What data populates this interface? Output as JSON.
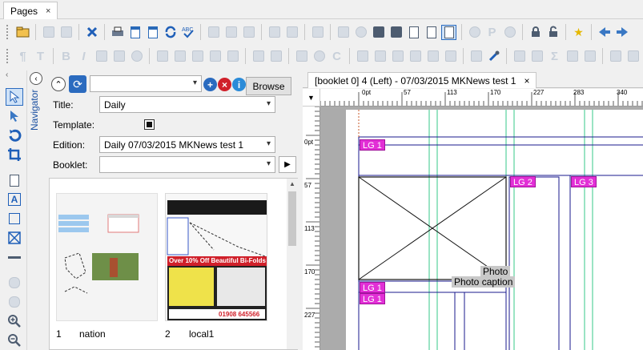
{
  "app": {
    "pages_tab_label": "Pages",
    "tab_close": "×"
  },
  "navigator": {
    "label": "Navigator"
  },
  "panel": {
    "browse_label": "Browse",
    "title_label": "Title:",
    "title_value": "Daily",
    "template_label": "Template:",
    "edition_label": "Edition:",
    "edition_value": "Daily 07/03/2015 MKNews test 1",
    "booklet_label": "Booklet:",
    "booklet_value": "",
    "thumbnails": [
      {
        "number": "1",
        "name": "nation"
      },
      {
        "number": "2",
        "name": "local1"
      }
    ],
    "ad_headline": "Over 10% Off Beautiful Bi-Folds",
    "ad_phone": "01908 645566"
  },
  "document": {
    "tab_label": "[booklet 0] 4 (Left) - 07/03/2015 MKNews test 1",
    "ruler_h_labels": [
      "0pt",
      "57",
      "113",
      "170",
      "227",
      "283",
      "340"
    ],
    "ruler_v_labels": [
      "0pt",
      "57",
      "113",
      "170",
      "227"
    ],
    "frames": {
      "lg1_top": "LG 1",
      "lg2": "LG 2",
      "lg3": "LG 3",
      "lg1_a": "LG 1",
      "lg1_b": "LG 1",
      "photo": "Photo",
      "photo_caption": "Photo caption"
    }
  },
  "colors": {
    "accent_blue": "#2b6bbf",
    "tag_magenta": "#e22fd6",
    "guide_green": "#34c98a",
    "frame_navy": "#1a1a8c",
    "ad_red": "#d0202a"
  }
}
